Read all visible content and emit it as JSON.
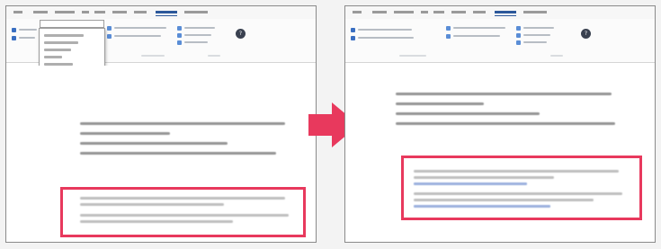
{
  "accent_colors": {
    "highlight": "#e8395d",
    "arrow": "#e8395d",
    "ribbon_active": "#2b579a"
  },
  "icons": {
    "arrow": "right-arrow-icon",
    "help": "help-icon"
  },
  "help_glyph": "?"
}
